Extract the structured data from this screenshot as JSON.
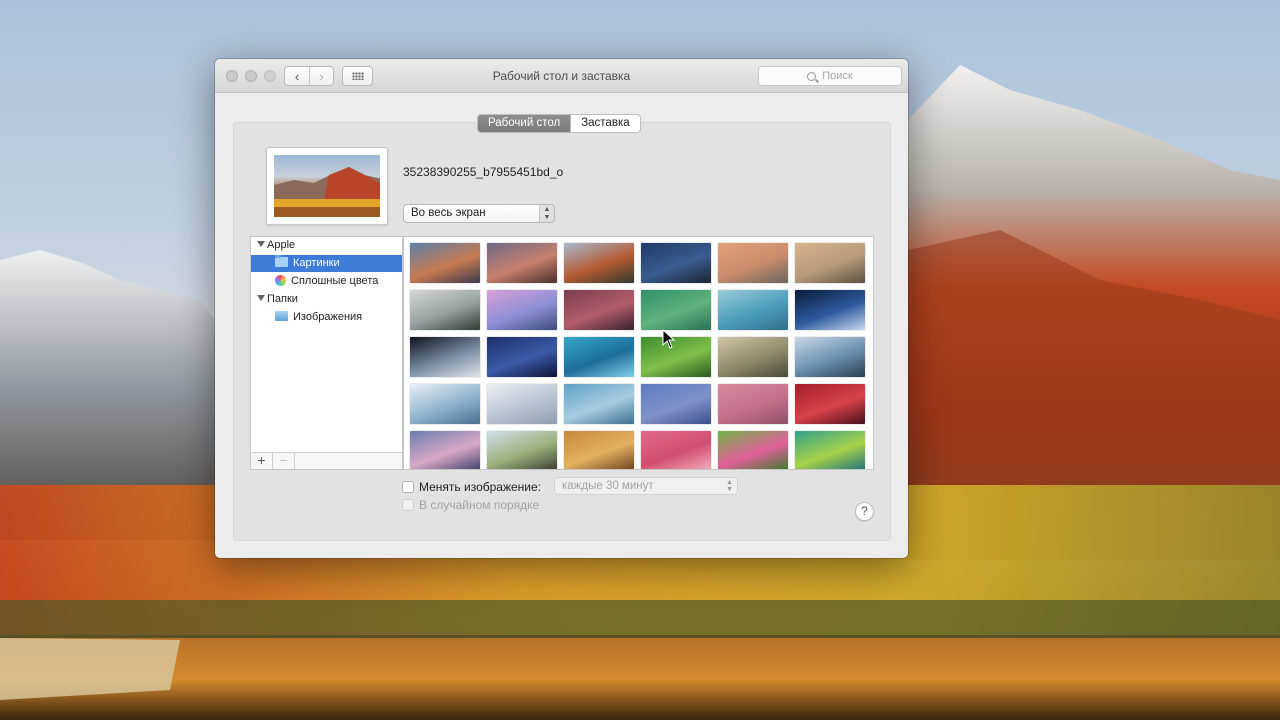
{
  "window": {
    "title": "Рабочий стол и заставка",
    "search_placeholder": "Поиск"
  },
  "tabs": [
    {
      "label": "Рабочий стол",
      "active": true
    },
    {
      "label": "Заставка",
      "active": false
    }
  ],
  "current": {
    "filename": "35238390255_b7955451bd_o",
    "fit_mode": "Во весь экран"
  },
  "sidebar": {
    "groups": [
      {
        "label": "Apple",
        "items": [
          {
            "label": "Картинки",
            "icon": "folder-icon",
            "selected": true
          },
          {
            "label": "Сплошные цвета",
            "icon": "colors-icon",
            "selected": false
          }
        ]
      },
      {
        "label": "Папки",
        "items": [
          {
            "label": "Изображения",
            "icon": "pictures-icon",
            "selected": false
          }
        ]
      }
    ],
    "add_label": "+",
    "remove_label": "−"
  },
  "options": {
    "change_picture_label": "Менять изображение:",
    "change_picture_checked": false,
    "interval_value": "каждые 30 минут",
    "random_order_label": "В случайном порядке",
    "random_order_checked": false,
    "help_label": "?"
  },
  "gallery": {
    "thumbnails": [
      {
        "name": "sierra-peaks",
        "colors": [
          "#5a7fa8",
          "#c87b52",
          "#3b3a4a"
        ]
      },
      {
        "name": "desert-dusk",
        "colors": [
          "#6e6a86",
          "#c8806e",
          "#4a2f2c"
        ]
      },
      {
        "name": "el-capitan",
        "colors": [
          "#a7b9cf",
          "#b55a32",
          "#2f3a2a"
        ]
      },
      {
        "name": "yosemite-night",
        "colors": [
          "#1f3a6a",
          "#3b5c8f",
          "#1b2433"
        ]
      },
      {
        "name": "half-dome-sunset",
        "colors": [
          "#e2a27a",
          "#c98b6a",
          "#6a6660"
        ]
      },
      {
        "name": "half-dome-day",
        "colors": [
          "#d8b48c",
          "#b79a7a",
          "#5a5040"
        ]
      },
      {
        "name": "foggy-forest",
        "colors": [
          "#d4d7d8",
          "#97a0a0",
          "#2c3a32"
        ]
      },
      {
        "name": "half-dome-purple",
        "colors": [
          "#d7a1d8",
          "#8d8fd6",
          "#3c4c7a"
        ]
      },
      {
        "name": "mono-lake",
        "colors": [
          "#7a3e4f",
          "#b35c6a",
          "#372232"
        ]
      },
      {
        "name": "green-wave",
        "colors": [
          "#2f8f6a",
          "#5fb37d",
          "#2a6f55"
        ]
      },
      {
        "name": "ocean-wave",
        "colors": [
          "#9ccbd8",
          "#4a9dbb",
          "#2e6f8c"
        ]
      },
      {
        "name": "earth-horizon",
        "colors": [
          "#0b1a3a",
          "#2d5a9e",
          "#c8d8f0"
        ]
      },
      {
        "name": "earth-from-space",
        "colors": [
          "#0e1220",
          "#7b8fa6",
          "#dfe4ea"
        ]
      },
      {
        "name": "galaxy",
        "colors": [
          "#1c2e6b",
          "#3c5aa8",
          "#0c1436"
        ]
      },
      {
        "name": "aqua-abstract",
        "colors": [
          "#35a7c9",
          "#1c6e9a",
          "#7cd0e6"
        ]
      },
      {
        "name": "green-field",
        "colors": [
          "#3c8d2e",
          "#7fc04a",
          "#2a5a20"
        ]
      },
      {
        "name": "desert-dunes",
        "colors": [
          "#cfc6a6",
          "#8f8a6a",
          "#4a4a3a"
        ]
      },
      {
        "name": "misty-hills",
        "colors": [
          "#c9d9e8",
          "#6a8fae",
          "#2a3f52"
        ]
      },
      {
        "name": "ice-crack",
        "colors": [
          "#e8f0f6",
          "#8fb2cd",
          "#4a6f8f"
        ]
      },
      {
        "name": "snow-dunes",
        "colors": [
          "#eceff3",
          "#b8c4d2",
          "#8c9cb0"
        ]
      },
      {
        "name": "frozen-lake",
        "colors": [
          "#5fa0c8",
          "#a8cde0",
          "#3a6f90"
        ]
      },
      {
        "name": "blue-sand",
        "colors": [
          "#5d7ac0",
          "#7f92c9",
          "#3b4f8c"
        ]
      },
      {
        "name": "pink-sand",
        "colors": [
          "#d98a9e",
          "#c66f8a",
          "#8f4f6a"
        ]
      },
      {
        "name": "red-poppy",
        "colors": [
          "#a41d2b",
          "#d8424a",
          "#4a0f1a"
        ]
      },
      {
        "name": "lake-dawn",
        "colors": [
          "#6a7fae",
          "#d9a7c6",
          "#3a3f6a"
        ]
      },
      {
        "name": "elephant",
        "colors": [
          "#cfe0ec",
          "#9ab07a",
          "#3a3a32"
        ]
      },
      {
        "name": "lion",
        "colors": [
          "#c88a3c",
          "#e2b060",
          "#6a3f1a"
        ]
      },
      {
        "name": "pink-feathers",
        "colors": [
          "#e06a8a",
          "#d14f70",
          "#f4b0c0"
        ]
      },
      {
        "name": "flowers",
        "colors": [
          "#72b347",
          "#e0609a",
          "#3a7a2a"
        ]
      },
      {
        "name": "green-abstract",
        "colors": [
          "#2fa38a",
          "#a8d24a",
          "#1a6f7a"
        ]
      }
    ]
  },
  "colors": {
    "selection": "#3d7bd8",
    "active_tab": "#838383"
  }
}
